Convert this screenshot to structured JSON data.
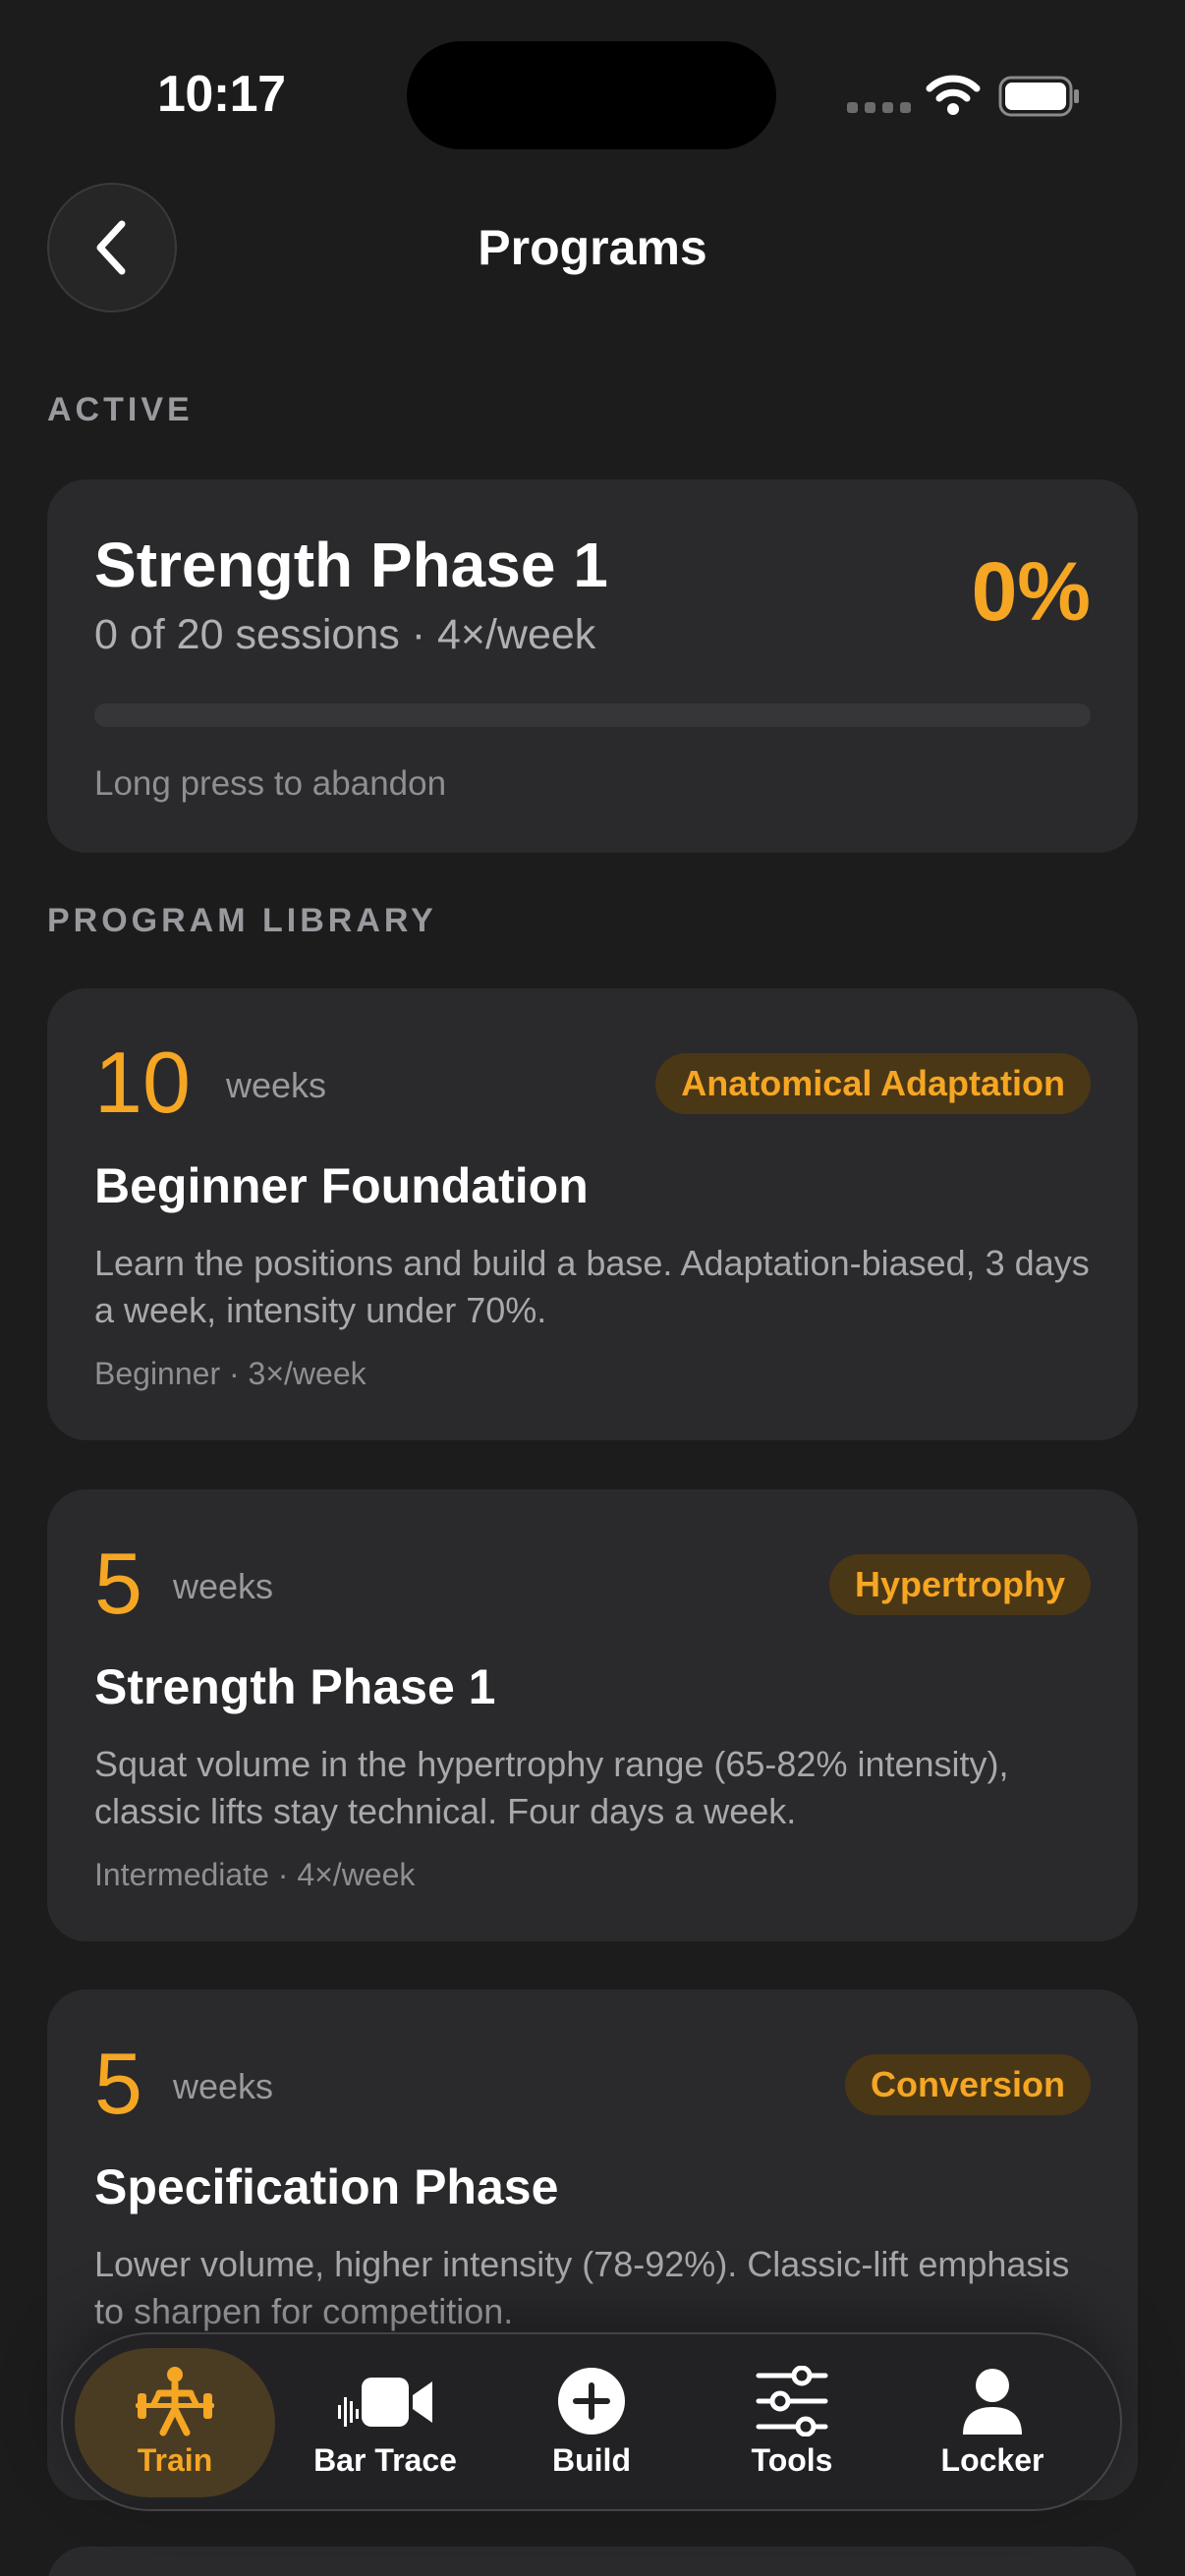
{
  "status_bar": {
    "time": "10:17"
  },
  "header": {
    "title": "Programs"
  },
  "sections": {
    "active": "ACTIVE",
    "library": "PROGRAM LIBRARY"
  },
  "active_program": {
    "title": "Strength Phase 1",
    "subtitle": "0 of 20 sessions · 4×/week",
    "percent_label": "0%",
    "progress": 0,
    "hint": "Long press to abandon"
  },
  "programs": [
    {
      "duration": "10",
      "unit": "weeks",
      "badge": "Anatomical Adaptation",
      "title": "Beginner Foundation",
      "description": "Learn the positions and build a base. Adaptation-biased, 3 days a week, intensity under 70%.",
      "meta": "Beginner · 3×/week"
    },
    {
      "duration": "5",
      "unit": "weeks",
      "badge": "Hypertrophy",
      "title": "Strength Phase 1",
      "description": "Squat volume in the hypertrophy range (65-82% intensity), classic lifts stay technical. Four days a week.",
      "meta": "Intermediate · 4×/week"
    },
    {
      "duration": "5",
      "unit": "weeks",
      "badge": "Conversion",
      "title": "Specification Phase",
      "description": "Lower volume, higher intensity (78-92%). Classic-lift emphasis to sharpen for competition.",
      "meta": ""
    }
  ],
  "tabs": [
    {
      "label": "Train",
      "icon": "barbell-lifter-icon",
      "active": true
    },
    {
      "label": "Bar Trace",
      "icon": "video-camera-icon",
      "active": false
    },
    {
      "label": "Build",
      "icon": "plus-circle-icon",
      "active": false
    },
    {
      "label": "Tools",
      "icon": "sliders-icon",
      "active": false
    },
    {
      "label": "Locker",
      "icon": "person-icon",
      "active": false
    }
  ],
  "colors": {
    "accent": "#f5a623",
    "background": "#1c1c1d",
    "card": "#2a2a2c"
  }
}
